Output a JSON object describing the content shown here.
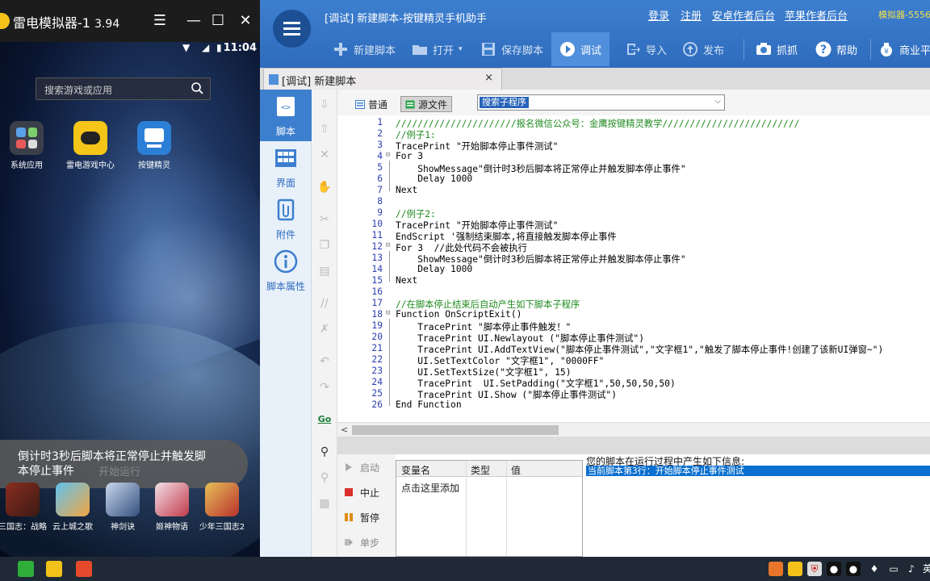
{
  "emulator": {
    "title": "雷电模拟器-1",
    "version": "3.94",
    "time": "11:04",
    "search_placeholder": "搜索游戏或应用",
    "apps": [
      {
        "label": "系统应用"
      },
      {
        "label": "雷电游戏中心"
      },
      {
        "label": "按键精灵"
      }
    ],
    "toast_line1": "倒计时3秒后脚本将正常停止并触发脚",
    "toast_line2": "本停止事件",
    "toast_ghost": "开始运行",
    "games": [
      {
        "label": "三国志：战略"
      },
      {
        "label": "云上城之歌"
      },
      {
        "label": "神剑诀"
      },
      {
        "label": "姬神物语"
      },
      {
        "label": "少年三国志2"
      }
    ]
  },
  "app": {
    "window_title": "[调试] 新建脚本-按键精灵手机助手",
    "links": {
      "login": "登录",
      "register": "注册",
      "android_author": "安卓作者后台",
      "apple_author": "苹果作者后台"
    },
    "simulator_label": "模拟器-5556",
    "toolbar": {
      "new_script": "新建脚本",
      "open": "打开",
      "save_script": "保存脚本",
      "debug": "调试",
      "import": "导入",
      "publish": "发布",
      "capture": "抓抓",
      "help": "帮助",
      "business": "商业平"
    },
    "doc_tab": "[调试] 新建脚本",
    "doc_tab_close": "×",
    "nav": [
      {
        "label": "脚本"
      },
      {
        "label": "界面"
      },
      {
        "label": "附件"
      },
      {
        "label": "脚本属性"
      }
    ],
    "editor_modes": {
      "normal": "普通",
      "source": "源文件"
    },
    "sub_combo_value": "搜索子程序",
    "code_lines": [
      "//////////////////////报名微信公众号：金鹰按键精灵教学/////////////////////////",
      "//例子1:",
      "TracePrint \"开始脚本停止事件测试\"",
      "For 3",
      "    ShowMessage\"倒计时3秒后脚本将正常停止并触发脚本停止事件\"",
      "    Delay 1000",
      "Next",
      "",
      "//例子2:",
      "TracePrint \"开始脚本停止事件测试\"",
      "EndScript '强制结束脚本,将直接触发脚本停止事件",
      "For 3  //此处代码不会被执行",
      "    ShowMessage\"倒计时3秒后脚本将正常停止并触发脚本停止事件\"",
      "    Delay 1000",
      "Next",
      "",
      "//在脚本停止结束后自动产生如下脚本子程序",
      "Function OnScriptExit()",
      "    TracePrint \"脚本停止事件触发！\"",
      "    TracePrint UI.Newlayout (\"脚本停止事件测试\")",
      "    TracePrint UI.AddTextView(\"脚本停止事件测试\",\"文字框1\",\"触发了脚本停止事件!创建了该新UI弹窗~\")",
      "    UI.SetTextColor \"文字框1\", \"0000FF\"",
      "    UI.SetTextSize(\"文字框1\", 15)",
      "    TracePrint  UI.SetPadding(\"文字框1\",50,50,50,50)",
      "    TracePrint UI.Show (\"脚本停止事件测试\")",
      "End Function"
    ],
    "debug_buttons": {
      "start": "启动",
      "stop": "中止",
      "pause": "暂停",
      "step": "单步"
    },
    "vars": {
      "col_name": "变量名",
      "col_type": "类型",
      "col_value": "值",
      "add_hint": "点击这里添加"
    },
    "log_header": "您的脚本在运行过程中产生如下信息:",
    "log_line": "当前脚本第3行：开始脚本停止事件测试"
  },
  "colors": {
    "toolbar_blue": "#3d7fcf",
    "selection": "#0a6fcf",
    "comment": "#1f8a1f",
    "keyword": "#00007f"
  }
}
